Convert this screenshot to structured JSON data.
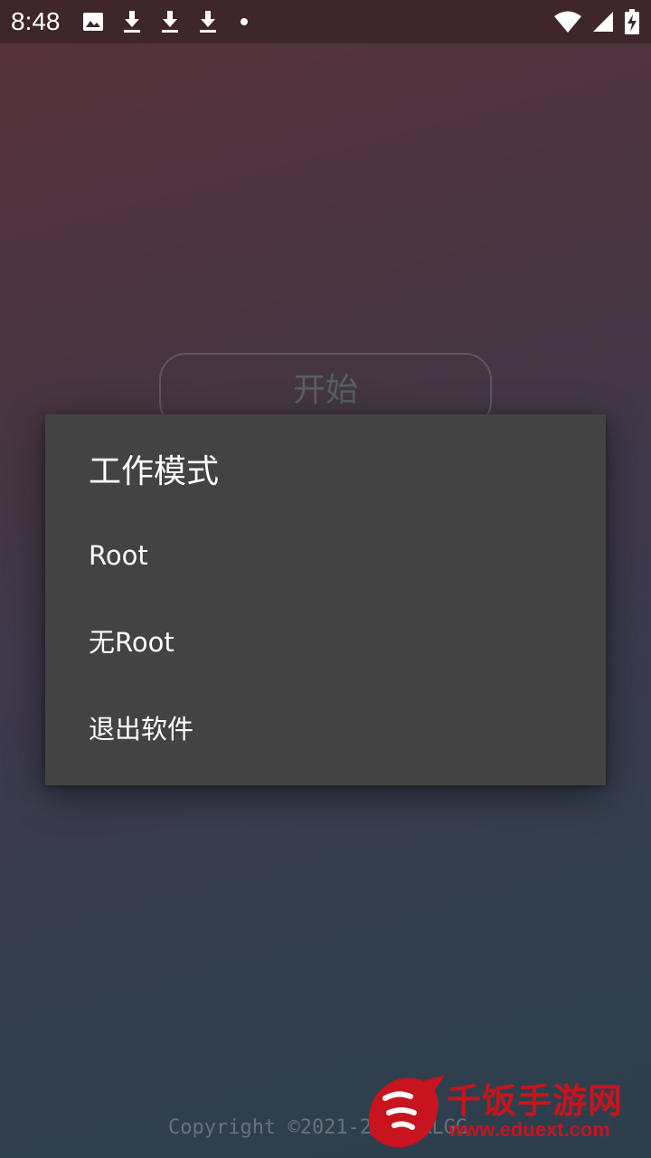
{
  "status_bar": {
    "time": "8:48",
    "left_icons": [
      "image-icon",
      "download-icon",
      "download-icon",
      "download-icon",
      "dot-icon"
    ],
    "right_icons": [
      "wifi-icon",
      "signal-icon",
      "battery-charging-icon"
    ]
  },
  "main": {
    "start_label": "开始",
    "copyright": "Copyright ©2021-2030 RLGG"
  },
  "dialog": {
    "title": "工作模式",
    "options": [
      {
        "label": "Root"
      },
      {
        "label": "无Root"
      },
      {
        "label": "退出软件"
      }
    ]
  },
  "watermark": {
    "title": "千饭手游网",
    "url": "www.eduext.com"
  },
  "colors": {
    "status_bar": "#3e262b",
    "dialog_bg": "#434343",
    "watermark_red": "#c8141e"
  }
}
